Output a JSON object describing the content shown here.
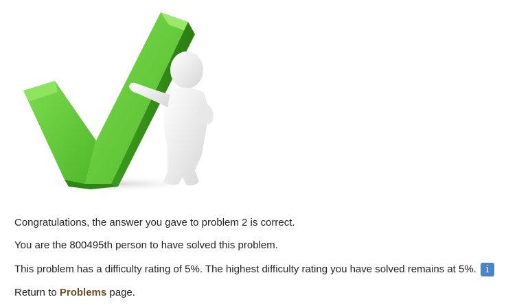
{
  "illustration": {
    "icon": "checkmark-with-figure-illustration",
    "check_color": "#5cc436",
    "check_dark": "#3c9a1f",
    "figure_color": "#f2f2f2"
  },
  "messages": {
    "congrats": "Congratulations, the answer you gave to problem 2 is correct.",
    "solver_count": "You are the 800495th person to have solved this problem.",
    "difficulty": "This problem has a difficulty rating of 5%. The highest difficulty rating you have solved remains at 5%.",
    "info_glyph": "i",
    "return_prefix": "Return to",
    "return_link": "Problems",
    "return_suffix": "page."
  }
}
